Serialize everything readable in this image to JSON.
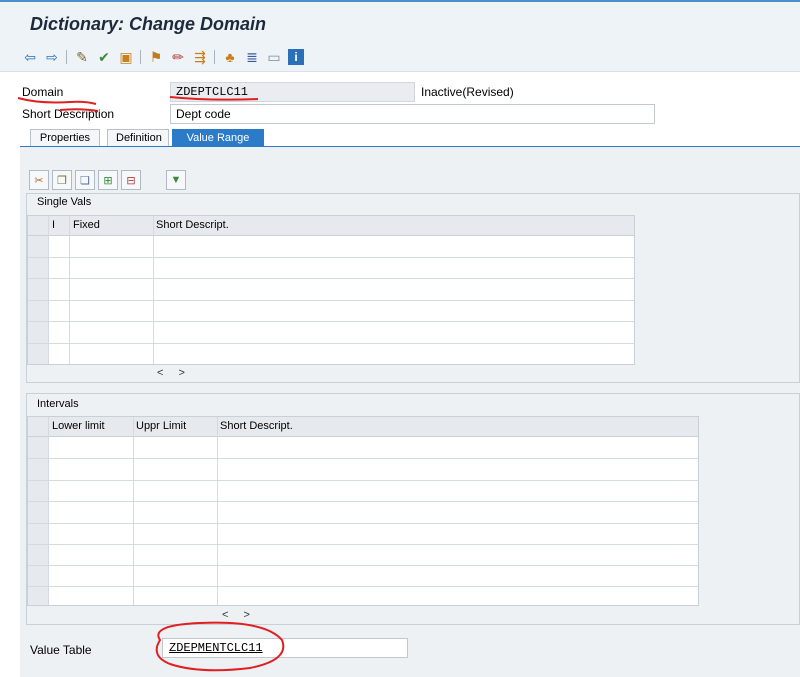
{
  "window": {
    "title": "Dictionary: Change Domain"
  },
  "toolbar": {
    "icons": [
      "back-arrow-icon",
      "forward-arrow-icon",
      "display-change-icon",
      "check-icon",
      "activate-icon",
      "where-used-icon",
      "object-list-icon",
      "navigation-window-icon",
      "hierarchy-icon",
      "stack-icon",
      "screen-icon",
      "info-icon"
    ]
  },
  "header": {
    "domain_label": "Domain",
    "domain_value": "ZDEPTCLC11",
    "status": "Inactive(Revised)",
    "short_desc_label": "Short Description",
    "short_desc_value": "Dept code"
  },
  "tabs": [
    "Properties",
    "Definition",
    "Value Range"
  ],
  "active_tab": "Value Range",
  "single_vals": {
    "title": "Single Vals",
    "columns": [
      "I",
      "Fixed",
      "Short Descript."
    ]
  },
  "intervals": {
    "title": "Intervals",
    "columns": [
      "Lower limit",
      "Uppr Limit",
      "Short Descript."
    ]
  },
  "scroll_arrows": "< >",
  "value_table": {
    "label": "Value Table",
    "value": "ZDEPMENTCLC11"
  },
  "colors": {
    "accent": "#2b7bc8",
    "annotation": "#e02020"
  }
}
